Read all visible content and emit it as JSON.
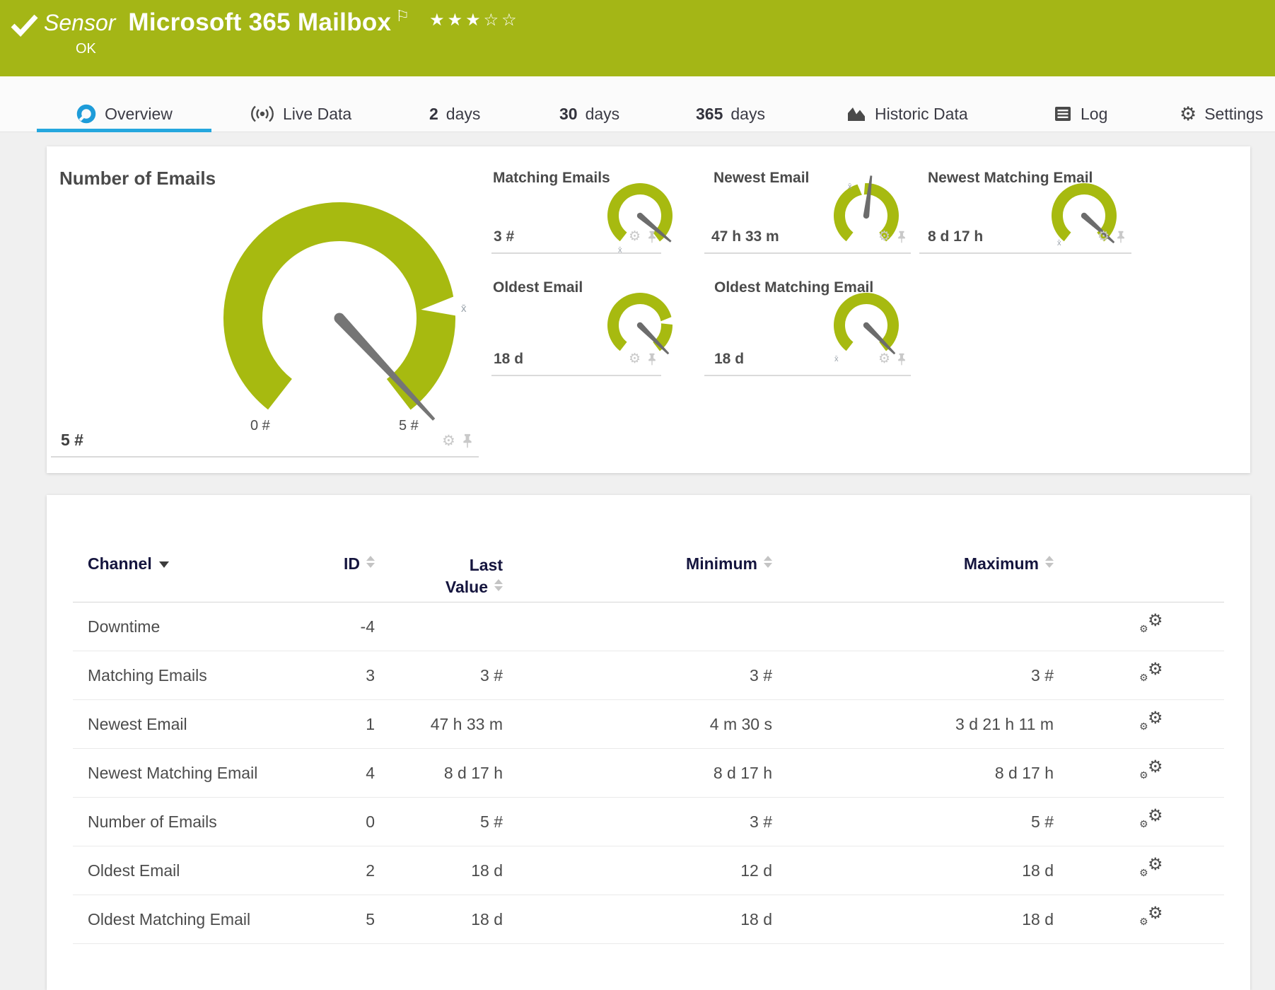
{
  "header": {
    "kind_label": "Sensor",
    "title": "Microsoft 365 Mailbox",
    "status": "OK",
    "stars_filled": "★★★",
    "stars_empty": "☆☆",
    "flag": "⚐"
  },
  "tabs": {
    "overview": "Overview",
    "live_data": "Live Data",
    "d2_num": "2",
    "d2_label": "days",
    "d30_num": "30",
    "d30_label": "days",
    "d365_num": "365",
    "d365_label": "days",
    "historic": "Historic Data",
    "log": "Log",
    "settings": "Settings"
  },
  "gauges": {
    "main": {
      "title": "Number of Emails",
      "value": "5 #",
      "scale_min": "0 #",
      "scale_max": "5 #"
    },
    "tiles": [
      {
        "title": "Matching Emails",
        "value": "3 #"
      },
      {
        "title": "Newest Email",
        "value": "47 h 33 m"
      },
      {
        "title": "Newest Matching Email",
        "value": "8 d 17 h"
      },
      {
        "title": "Oldest Email",
        "value": "18 d"
      },
      {
        "title": "Oldest Matching Email",
        "value": "18 d"
      }
    ],
    "avg_marker": "x̄"
  },
  "table": {
    "headers": {
      "channel": "Channel",
      "id": "ID",
      "last_line1": "Last",
      "last_line2": "Value",
      "minimum": "Minimum",
      "maximum": "Maximum"
    },
    "rows": [
      {
        "channel": "Downtime",
        "id": "-4",
        "last": "",
        "min": "",
        "max": ""
      },
      {
        "channel": "Matching Emails",
        "id": "3",
        "last": "3 #",
        "min": "3 #",
        "max": "3 #"
      },
      {
        "channel": "Newest Email",
        "id": "1",
        "last": "47 h 33 m",
        "min": "4 m 30 s",
        "max": "3 d 21 h 11 m"
      },
      {
        "channel": "Newest Matching Email",
        "id": "4",
        "last": "8 d 17 h",
        "min": "8 d 17 h",
        "max": "8 d 17 h"
      },
      {
        "channel": "Number of Emails",
        "id": "0",
        "last": "5 #",
        "min": "3 #",
        "max": "5 #"
      },
      {
        "channel": "Oldest Email",
        "id": "2",
        "last": "18 d",
        "min": "12 d",
        "max": "18 d"
      },
      {
        "channel": "Oldest Matching Email",
        "id": "5",
        "last": "18 d",
        "min": "18 d",
        "max": "18 d"
      }
    ]
  },
  "icons": {
    "gear": "⚙"
  },
  "colors": {
    "header_green": "#a4b616",
    "gauge_green": "#a7ba10",
    "accent_blue": "#25a7de",
    "needle_gray": "#757575",
    "table_header_text": "#15153e"
  }
}
